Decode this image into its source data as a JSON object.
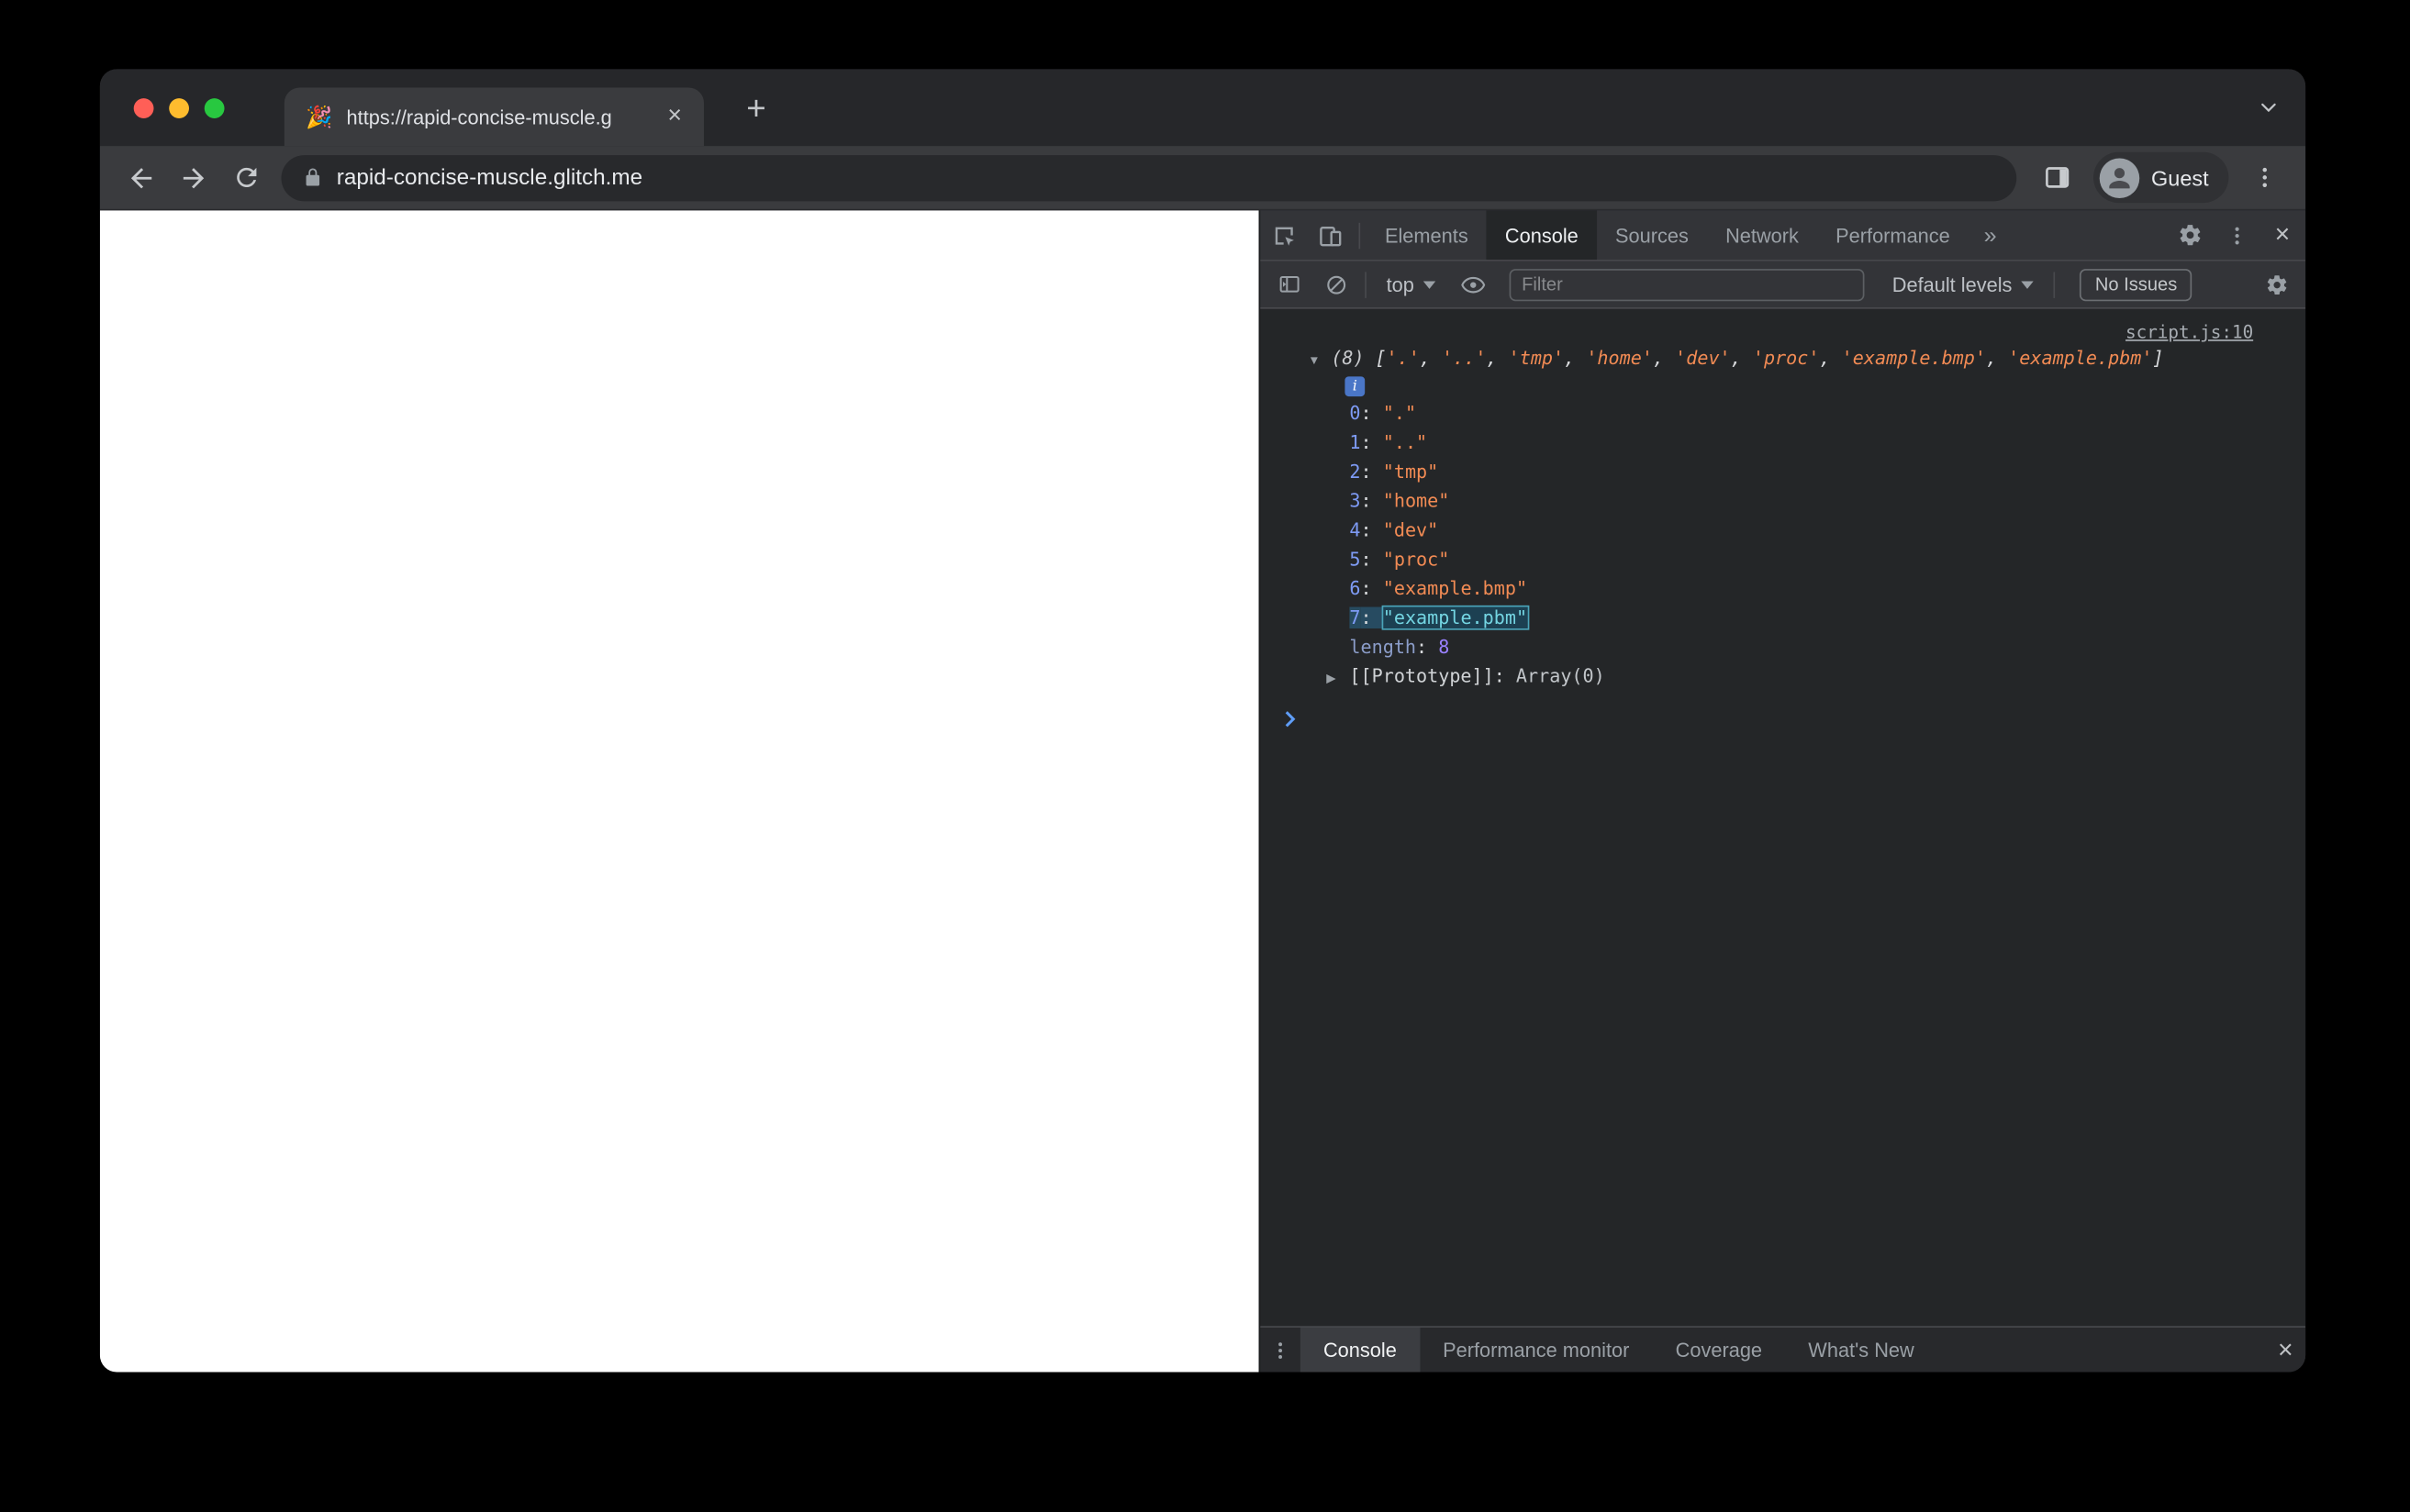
{
  "colors": {
    "string": "#f28b54",
    "key": "#7e9bf5",
    "num": "#9980ff",
    "hl-text": "#74d5e2",
    "traffic-red": "#ff5f57",
    "traffic-yellow": "#febc2e",
    "traffic-green": "#28c840"
  },
  "browser": {
    "tab": {
      "favicon": "🎉",
      "title": "https://rapid-concise-muscle.g",
      "close_icon": "×"
    },
    "new_tab_icon": "+",
    "url": "rapid-concise-muscle.glitch.me",
    "profile": {
      "label": "Guest"
    }
  },
  "devtools": {
    "tabs": [
      {
        "label": "Elements"
      },
      {
        "label": "Console",
        "active": true
      },
      {
        "label": "Sources"
      },
      {
        "label": "Network"
      },
      {
        "label": "Performance"
      }
    ],
    "more_tabs_icon": "»",
    "close_icon": "×",
    "toolbar": {
      "context_label": "top",
      "filter_placeholder": "Filter",
      "levels_label": "Default levels",
      "issues_label": "No Issues"
    },
    "console": {
      "source_link": "script.js:10",
      "entry": {
        "expanded_icon": "▼",
        "collapsed_icon": "▶",
        "info_icon": "i",
        "count": "(8)",
        "bracket_open": "[",
        "bracket_close": "]",
        "separator": ", ",
        "key_separator": ": ",
        "preview_items": [
          "'.'",
          "'..'",
          "'tmp'",
          "'home'",
          "'dev'",
          "'proc'",
          "'example.bmp'",
          "'example.pbm'"
        ],
        "items": [
          {
            "index": "0",
            "value": "\".\""
          },
          {
            "index": "1",
            "value": "\"..\""
          },
          {
            "index": "2",
            "value": "\"tmp\""
          },
          {
            "index": "3",
            "value": "\"home\""
          },
          {
            "index": "4",
            "value": "\"dev\""
          },
          {
            "index": "5",
            "value": "\"proc\""
          },
          {
            "index": "6",
            "value": "\"example.bmp\""
          },
          {
            "index": "7",
            "value": "\"example.pbm\"",
            "highlighted": true
          }
        ],
        "length_label": "length",
        "length_value": "8",
        "prototype_label": "[[Prototype]]",
        "prototype_value": "Array(0)"
      }
    },
    "drawer": {
      "tabs": [
        {
          "label": "Console",
          "active": true
        },
        {
          "label": "Performance monitor"
        },
        {
          "label": "Coverage"
        },
        {
          "label": "What's New"
        }
      ]
    }
  }
}
